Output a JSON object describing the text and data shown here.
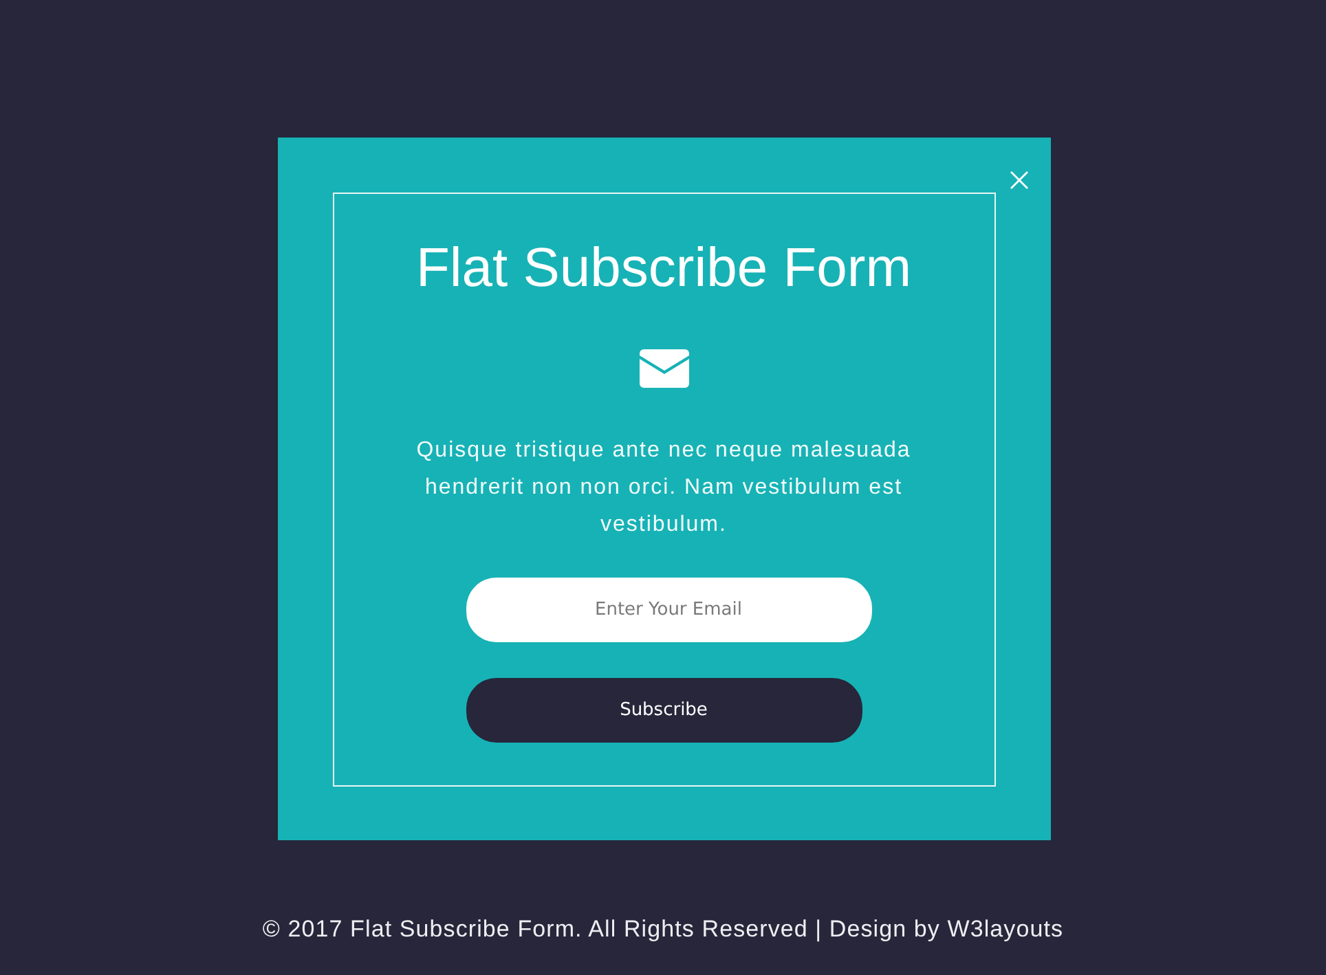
{
  "modal": {
    "title": "Flat Subscribe Form",
    "description": "Quisque tristique ante nec neque malesuada hendrerit non non orci. Nam vestibulum est vestibulum.",
    "email_field": {
      "placeholder": "Enter Your Email"
    },
    "subscribe_button": {
      "label": "Subscribe"
    }
  },
  "footer": {
    "text": "© 2017 Flat Subscribe Form. All Rights Reserved | Design by",
    "link": "W3layouts"
  }
}
